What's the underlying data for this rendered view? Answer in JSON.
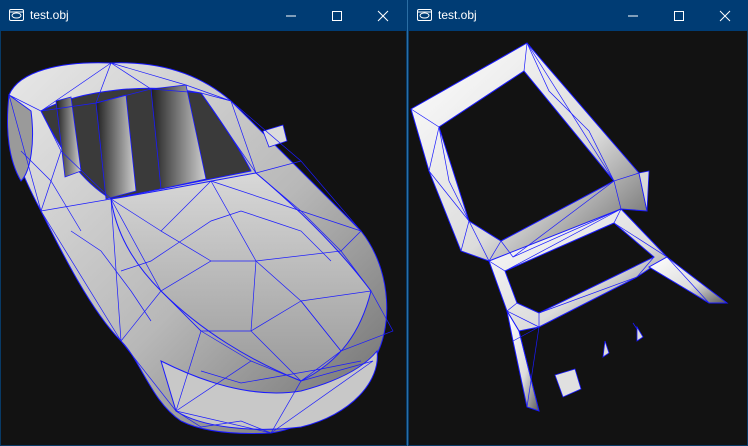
{
  "colors": {
    "titlebar": "#003c74",
    "viewport_bg": "#121212",
    "wire": "#1a1aff",
    "surface_light": "#f0f0f0",
    "surface_dark": "#3a3a3a"
  },
  "windows": [
    {
      "title": "test.obj",
      "icon": "app-window-icon",
      "controls": [
        "minimize-icon",
        "maximize-icon",
        "close-icon"
      ],
      "content": "shaded wireframe car body, top-down three-quarter view"
    },
    {
      "title": "test.obj",
      "icon": "app-window-icon",
      "controls": [
        "minimize-icon",
        "maximize-icon",
        "close-icon"
      ],
      "content": "shaded wireframe car frame (windows and pillars), top-down view"
    }
  ]
}
